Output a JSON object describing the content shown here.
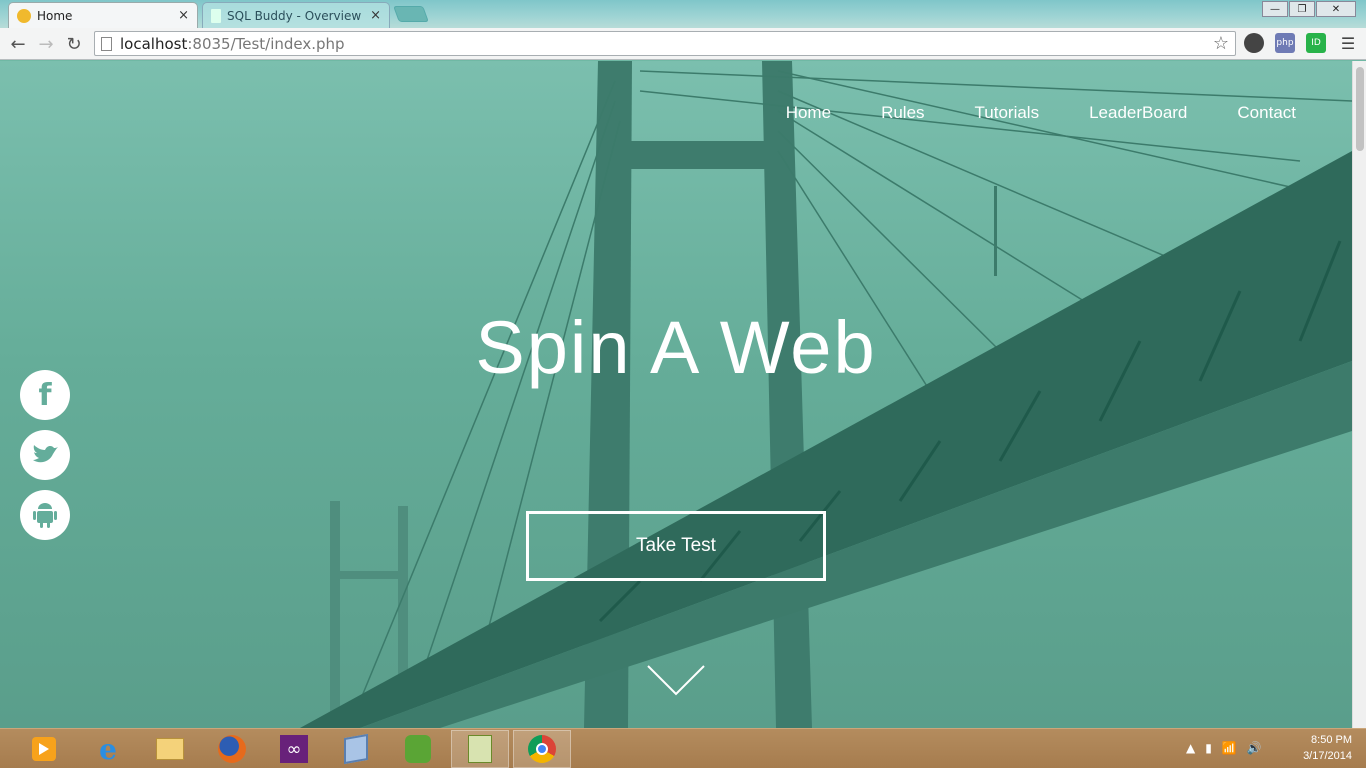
{
  "browser": {
    "tabs": [
      {
        "label": "Home",
        "active": true
      },
      {
        "label": "SQL Buddy - Overview - s",
        "active": false
      }
    ],
    "window_controls": [
      "minimize",
      "restore",
      "close"
    ],
    "address": {
      "host": "localhost",
      "rest": ":8035/Test/index.php"
    },
    "extensions": [
      "chrome-icon",
      "php-icon",
      "id-icon",
      "menu-icon"
    ]
  },
  "site": {
    "nav": [
      "Home",
      "Rules",
      "Tutorials",
      "LeaderBoard",
      "Contact"
    ],
    "title": "Spin A Web",
    "cta": "Take Test",
    "social": [
      {
        "name": "facebook-icon",
        "glyph": "f"
      },
      {
        "name": "twitter-icon",
        "glyph": ""
      },
      {
        "name": "android-icon",
        "glyph": ""
      }
    ],
    "colors": {
      "overlay": "#6fb8a4",
      "text": "#ffffff"
    }
  },
  "taskbar": {
    "apps": [
      "media-player-icon",
      "internet-explorer-icon",
      "file-explorer-icon",
      "firefox-icon",
      "visual-studio-icon",
      "virtualbox-icon",
      "evernote-icon",
      "notepadpp-icon",
      "chrome-icon"
    ],
    "time": "8:50 PM",
    "date": "3/17/2014"
  }
}
